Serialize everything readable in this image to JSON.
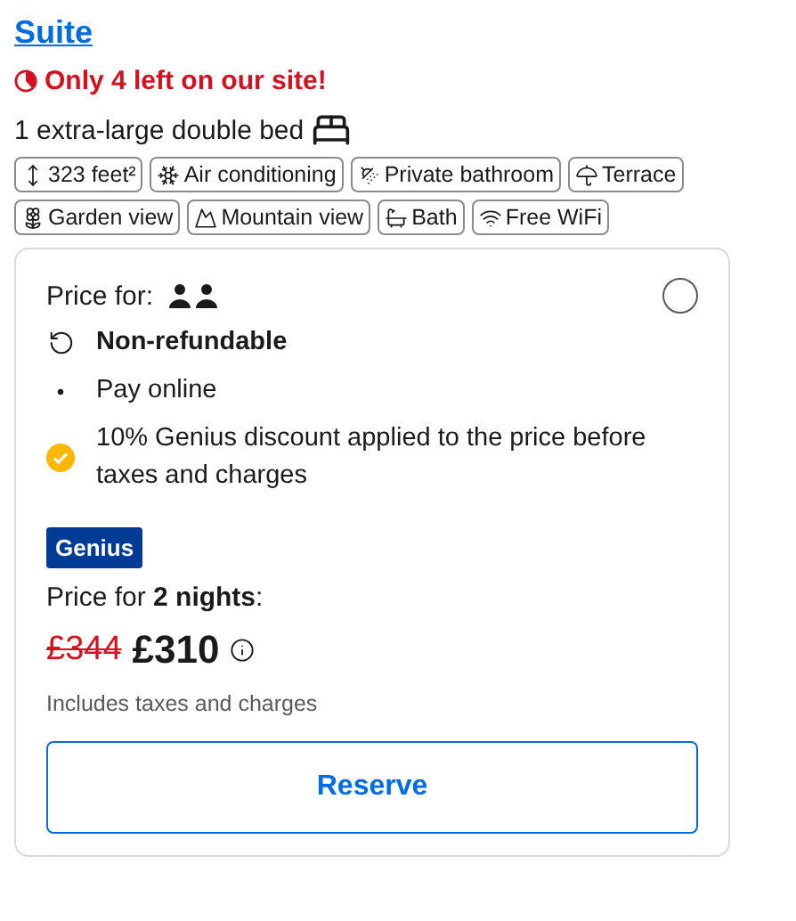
{
  "room": {
    "title": "Suite",
    "scarcity": "Only 4 left on our site!",
    "bed": "1 extra-large double bed"
  },
  "facilities": [
    {
      "kind": "size",
      "label": "323 feet²"
    },
    {
      "kind": "aircon",
      "label": "Air conditioning"
    },
    {
      "kind": "bathroom",
      "label": "Private bathroom"
    },
    {
      "kind": "terrace",
      "label": "Terrace"
    },
    {
      "kind": "garden",
      "label": "Garden view"
    },
    {
      "kind": "mountain",
      "label": "Mountain view"
    },
    {
      "kind": "bath",
      "label": "Bath"
    },
    {
      "kind": "wifi",
      "label": "Free WiFi"
    }
  ],
  "offer": {
    "price_for_label": "Price for:",
    "selected": false,
    "conditions": [
      {
        "kind": "refund",
        "text": "Non-refundable"
      },
      {
        "kind": "bullet",
        "text": "Pay online"
      },
      {
        "kind": "check",
        "text": "10% Genius discount applied to the price before taxes and charges"
      }
    ],
    "badge": "Genius",
    "nights_text": "Price for **2 nights**:",
    "old_price": "£344",
    "price": "£310",
    "taxes_note": "Includes taxes and charges",
    "button": "Reserve"
  }
}
